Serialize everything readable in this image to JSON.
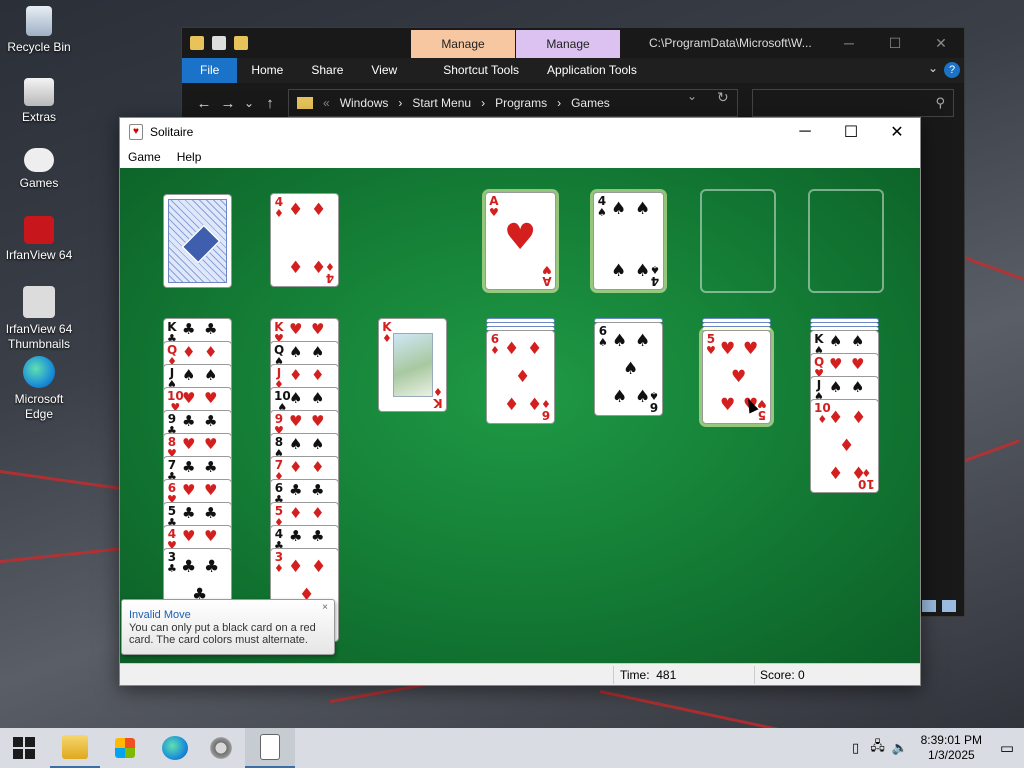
{
  "desktop": {
    "icons": [
      {
        "label": "Recycle Bin",
        "icon": "recycle-bin-icon"
      },
      {
        "label": "Extras",
        "icon": "folder-stack-icon"
      },
      {
        "label": "Games",
        "icon": "gamepad-icon"
      },
      {
        "label": "IrfanView 64",
        "icon": "irfanview-icon"
      },
      {
        "label": "IrfanView 64\nThumbnails",
        "icon": "irfanview-thumbnails-icon"
      },
      {
        "label": "Microsoft\nEdge",
        "icon": "edge-icon"
      }
    ]
  },
  "explorer": {
    "ctx_tab_1": "Manage",
    "ctx_tab_2": "Manage",
    "title_path": "C:\\ProgramData\\Microsoft\\W...",
    "win_min": "─",
    "win_max": "☐",
    "win_close": "✕",
    "ribbon": {
      "file": "File",
      "home": "Home",
      "share": "Share",
      "view": "View",
      "shortcut_tools": "Shortcut Tools",
      "application_tools": "Application Tools"
    },
    "nav": {
      "back": "←",
      "forward": "→",
      "recent": "⌄",
      "up": "↑"
    },
    "breadcrumb": [
      "«",
      "Windows",
      "›",
      "Start Menu",
      "›",
      "Programs",
      "›",
      "Games"
    ],
    "addr_dropdown": "⌄",
    "refresh": "↻",
    "search_glyph": "⚲"
  },
  "solitaire": {
    "title": "Solitaire",
    "menu": {
      "game": "Game",
      "help": "Help"
    },
    "win_min": "─",
    "win_max": "☐",
    "win_close": "✕",
    "status": {
      "time_label": "Time:",
      "time_value": "481",
      "score_label": "Score:",
      "score_value": "0"
    },
    "tooltip": {
      "title": "Invalid Move",
      "body": "You can only put a black card on a red card. The card colors must alternate.",
      "close": "×"
    },
    "waste": {
      "rank": "4",
      "suit": "♦",
      "color": "red"
    },
    "foundations": [
      {
        "rank": "A",
        "suit": "♥",
        "color": "red"
      },
      {
        "rank": "4",
        "suit": "♠",
        "color": "black"
      },
      null,
      null
    ],
    "tableau": [
      {
        "cards": [
          [
            "K",
            "♣",
            "b"
          ],
          [
            "Q",
            "♦",
            "r"
          ],
          [
            "J",
            "♠",
            "b"
          ],
          [
            "10",
            "♥",
            "r"
          ],
          [
            "9",
            "♣",
            "b"
          ],
          [
            "8",
            "♥",
            "r"
          ],
          [
            "7",
            "♣",
            "b"
          ],
          [
            "6",
            "♥",
            "r"
          ],
          [
            "5",
            "♣",
            "b"
          ],
          [
            "4",
            "♥",
            "r"
          ],
          [
            "3",
            "♣",
            "b"
          ]
        ]
      },
      {
        "cards": [
          [
            "K",
            "♥",
            "r"
          ],
          [
            "Q",
            "♠",
            "b"
          ],
          [
            "J",
            "♦",
            "r"
          ],
          [
            "10",
            "♠",
            "b"
          ],
          [
            "9",
            "♥",
            "r"
          ],
          [
            "8",
            "♠",
            "b"
          ],
          [
            "7",
            "♦",
            "r"
          ],
          [
            "6",
            "♣",
            "b"
          ],
          [
            "5",
            "♦",
            "r"
          ],
          [
            "4",
            "♣",
            "b"
          ],
          [
            "3",
            "♦",
            "r"
          ]
        ]
      },
      {
        "cards": [
          [
            "K",
            "♦",
            "r"
          ]
        ]
      },
      {
        "cards": [
          [
            "6",
            "♦",
            "r"
          ]
        ]
      },
      {
        "cards": [
          [
            "6",
            "♠",
            "b"
          ]
        ]
      },
      {
        "cards": [
          [
            "5",
            "♥",
            "r"
          ]
        ]
      },
      {
        "cards": [
          [
            "K",
            "♠",
            "b"
          ],
          [
            "Q",
            "♥",
            "r"
          ],
          [
            "J",
            "♠",
            "b"
          ],
          [
            "10",
            "♦",
            "r"
          ]
        ]
      }
    ]
  },
  "taskbar": {
    "clock_time": "8:39:01 PM",
    "clock_date": "1/3/2025",
    "tray_icons": [
      "usb-icon",
      "network-icon",
      "volume-muted-icon"
    ],
    "apps": [
      "file-explorer-icon",
      "store-icon",
      "edge-icon",
      "settings-gear-icon",
      "solitaire-icon"
    ],
    "notification_glyph": "▭"
  },
  "colors": {
    "felt": "#137a34",
    "red_suit": "#d41f1f",
    "accent": "#1a73c8"
  }
}
